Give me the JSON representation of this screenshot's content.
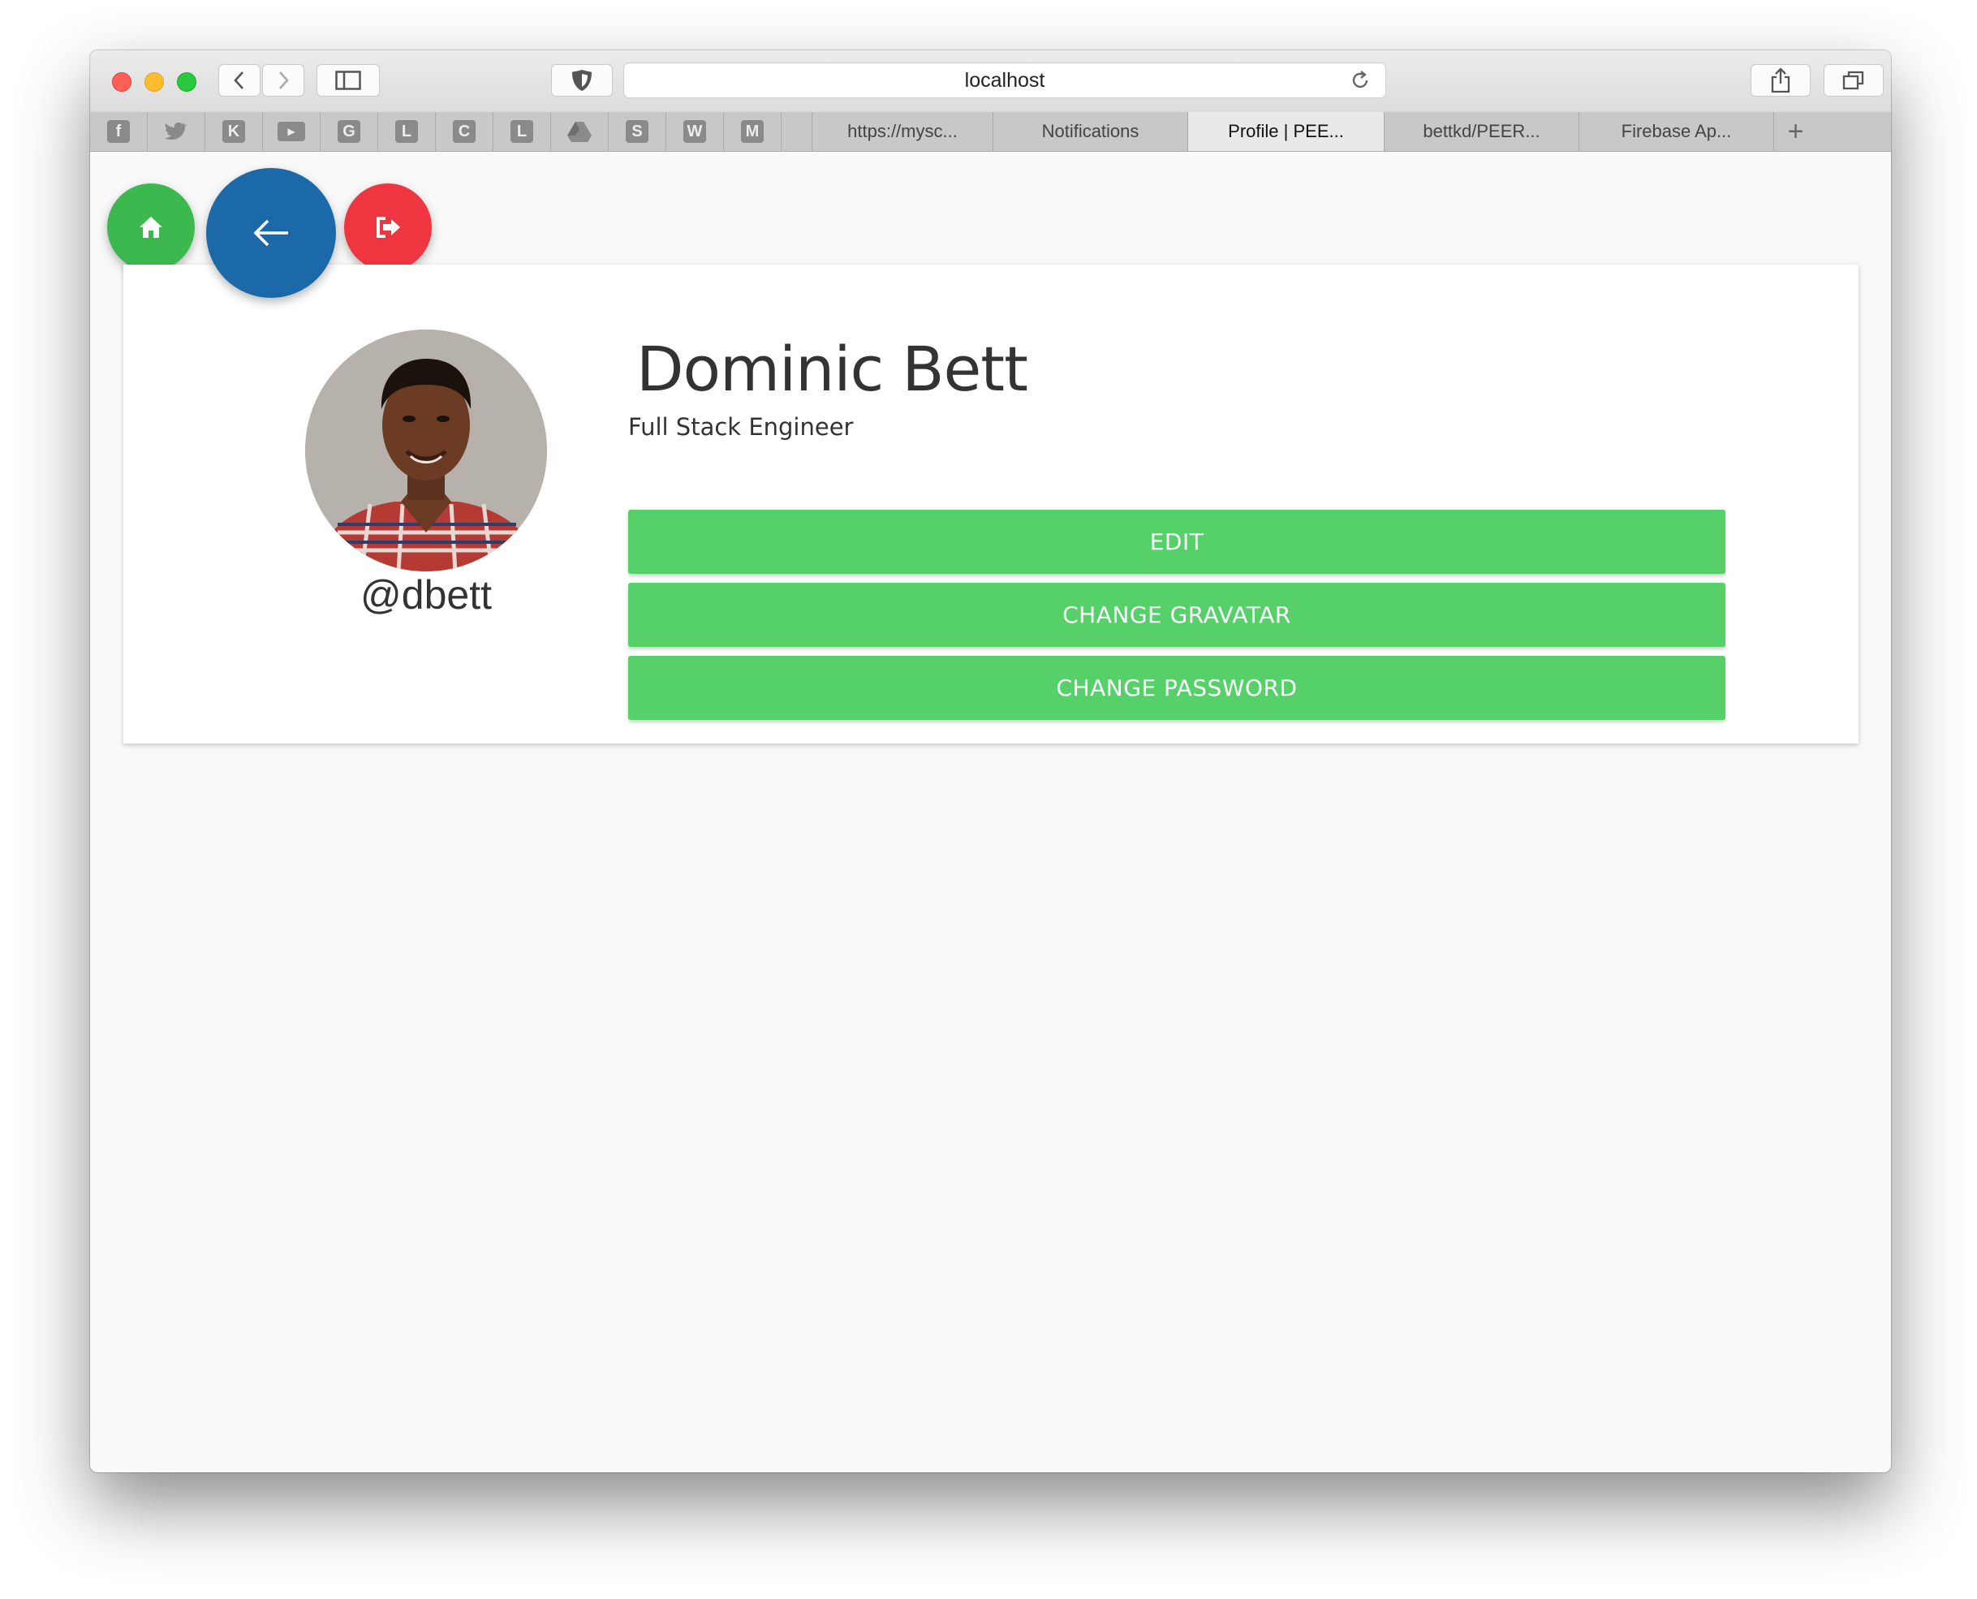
{
  "browser": {
    "url": "localhost",
    "favorites": [
      {
        "name": "facebook",
        "glyph": "f"
      },
      {
        "name": "twitter",
        "glyph": ""
      },
      {
        "name": "k",
        "glyph": "K"
      },
      {
        "name": "youtube",
        "glyph": "▶"
      },
      {
        "name": "g",
        "glyph": "G"
      },
      {
        "name": "l1",
        "glyph": "L"
      },
      {
        "name": "c",
        "glyph": "C"
      },
      {
        "name": "l2",
        "glyph": "L"
      },
      {
        "name": "drive",
        "glyph": ""
      },
      {
        "name": "s",
        "glyph": "S"
      },
      {
        "name": "w",
        "glyph": "W"
      },
      {
        "name": "m",
        "glyph": "M"
      }
    ],
    "tabs": [
      {
        "label": "https://mysc..."
      },
      {
        "label": "Notifications"
      },
      {
        "label": "Profile | PEE..."
      },
      {
        "label": "bettkd/PEER..."
      },
      {
        "label": "Firebase Ap..."
      }
    ],
    "new_tab_label": "+"
  },
  "profile": {
    "full_name": "Dominic Bett",
    "title": "Full Stack Engineer",
    "username": "@dbett"
  },
  "actions": {
    "edit": "EDIT",
    "change_gravatar": "CHANGE GRAVATAR",
    "change_password": "CHANGE PASSWORD"
  },
  "colors": {
    "home": "#3bb94f",
    "back": "#1b69a8",
    "logout": "#ef3640",
    "action_button": "#56d068"
  }
}
